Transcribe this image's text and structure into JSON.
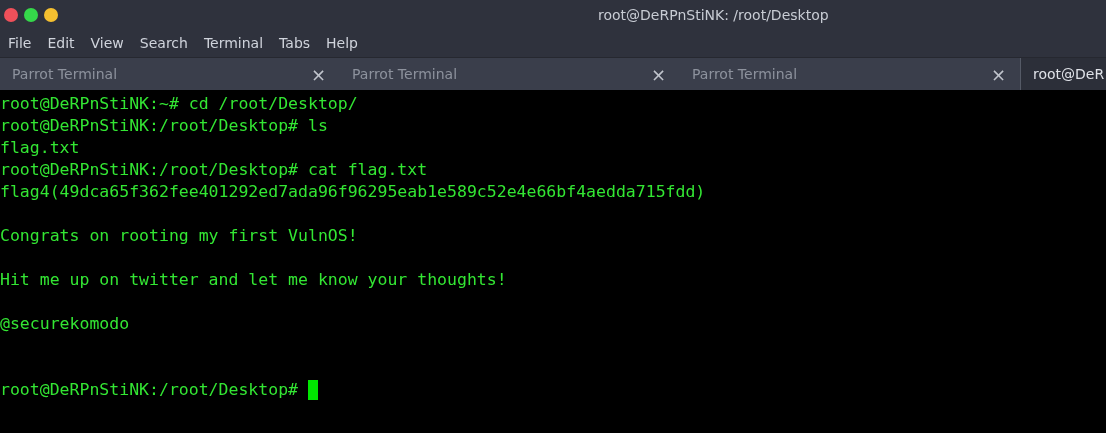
{
  "window": {
    "title": "root@DeRPnStiNK: /root/Desktop"
  },
  "menu": [
    "File",
    "Edit",
    "View",
    "Search",
    "Terminal",
    "Tabs",
    "Help"
  ],
  "tabs": [
    {
      "label": "Parrot Terminal",
      "selected": false,
      "closable": true
    },
    {
      "label": "Parrot Terminal",
      "selected": false,
      "closable": true
    },
    {
      "label": "Parrot Terminal",
      "selected": false,
      "closable": true
    },
    {
      "label": "root@DeR",
      "selected": true,
      "closable": false
    }
  ],
  "close_glyph": "×",
  "terminal": {
    "lines": [
      {
        "kind": "text",
        "text": "root@DeRPnStiNK:~# cd /root/Desktop/"
      },
      {
        "kind": "text",
        "text": "root@DeRPnStiNK:/root/Desktop# ls"
      },
      {
        "kind": "text",
        "text": "flag.txt"
      },
      {
        "kind": "text",
        "text": "root@DeRPnStiNK:/root/Desktop# cat flag.txt"
      },
      {
        "kind": "text",
        "text": "flag4(49dca65f362fee401292ed7ada96f96295eab1e589c52e4e66bf4aedda715fdd)"
      },
      {
        "kind": "blank"
      },
      {
        "kind": "text",
        "text": "Congrats on rooting my first VulnOS!"
      },
      {
        "kind": "blank"
      },
      {
        "kind": "text",
        "text": "Hit me up on twitter and let me know your thoughts!"
      },
      {
        "kind": "blank"
      },
      {
        "kind": "text",
        "text": "@securekomodo"
      },
      {
        "kind": "blank"
      },
      {
        "kind": "blank"
      },
      {
        "kind": "text",
        "text": "root@DeRPnStiNK:/root/Desktop#",
        "cursor": true
      }
    ]
  }
}
